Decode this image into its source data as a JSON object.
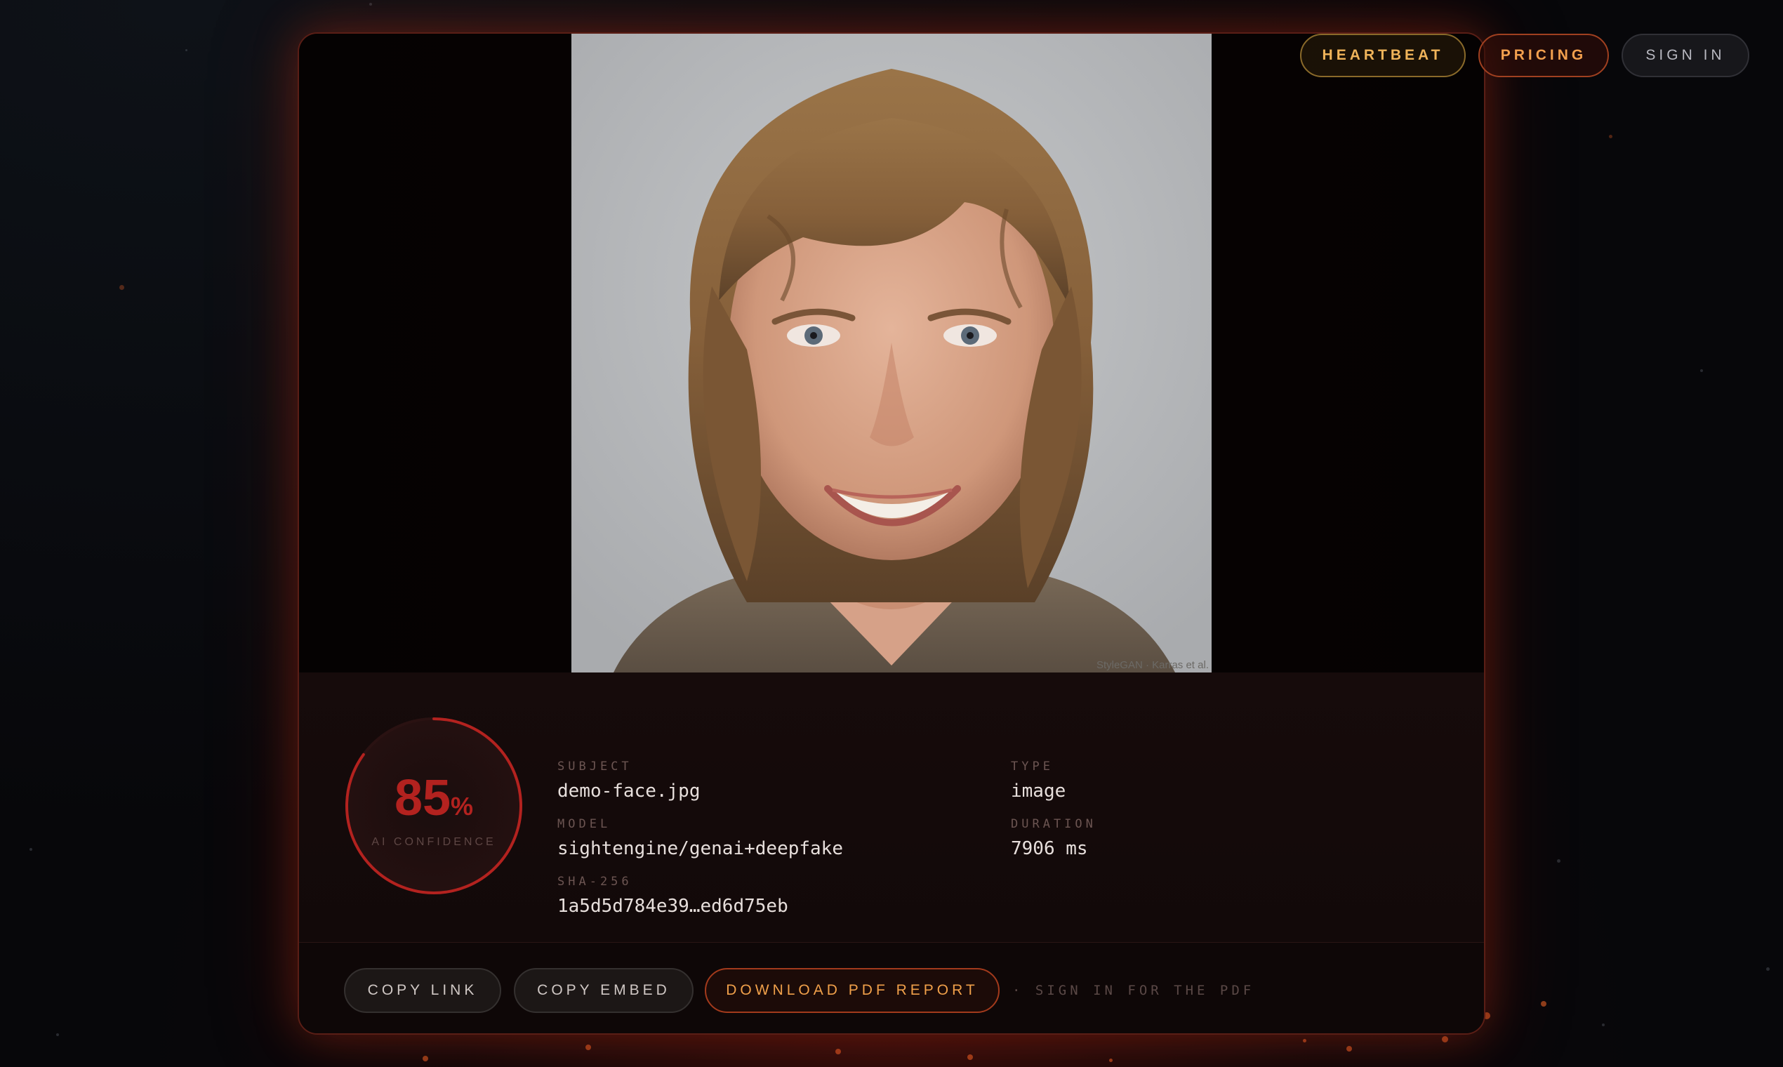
{
  "nav": {
    "heartbeat": "HEARTBEAT",
    "pricing": "PRICING",
    "sign_in": "SIGN IN"
  },
  "media": {
    "credit": "StyleGAN · Karras et al."
  },
  "result": {
    "confidence_value": "85",
    "confidence_unit": "%",
    "confidence_label": "AI CONFIDENCE",
    "confidence_fraction": 0.85
  },
  "fields": {
    "subject_label": "SUBJECT",
    "subject_value": "demo-face.jpg",
    "model_label": "MODEL",
    "model_value": "sightengine/genai+deepfake",
    "sha_label": "SHA-256",
    "sha_value": "1a5d5d784e39…ed6d75eb",
    "type_label": "TYPE",
    "type_value": "image",
    "duration_label": "DURATION",
    "duration_value": "7906 ms"
  },
  "actions": {
    "copy_link": "COPY LINK",
    "copy_embed": "COPY EMBED",
    "download_pdf": "DOWNLOAD PDF REPORT",
    "pdf_note": "· SIGN IN FOR THE PDF"
  },
  "colors": {
    "accent_red": "#b3221f",
    "accent_orange": "#f0a04a",
    "accent_gold": "#f0b45a",
    "background": "#07070a"
  }
}
